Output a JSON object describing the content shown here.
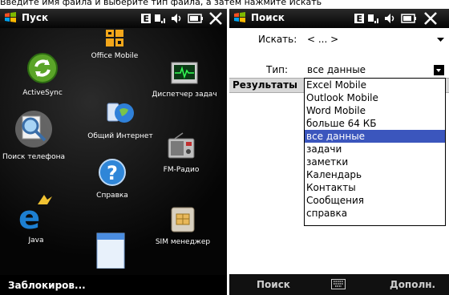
{
  "caption": "Введите имя файла и выберите тип файла, а затем нажмите Искать",
  "start_screen": {
    "title": "Пуск",
    "apps": [
      {
        "label": "Office Mobile"
      },
      {
        "label": "ActiveSync"
      },
      {
        "label": "Диспетчер задач"
      },
      {
        "label": "Общий Интернет"
      },
      {
        "label": "Поиск телефона"
      },
      {
        "label": "FM-Радио"
      },
      {
        "label": "Справка"
      },
      {
        "label": "Java"
      },
      {
        "label": "SIM менеджер"
      }
    ],
    "bottom_left": "Заблокиров..."
  },
  "search_screen": {
    "title": "Поиск",
    "search_label": "Искать:",
    "search_value": "< ... >",
    "type_label": "Тип:",
    "type_value": "все данные",
    "results_label": "Результаты",
    "dropdown_options": [
      "Excel Mobile",
      "Outlook Mobile",
      "Word Mobile",
      "больше 64 КБ",
      "все данные",
      "задачи",
      "заметки",
      "Календарь",
      "Контакты",
      "Сообщения",
      "справка"
    ],
    "selected_option": "все данные",
    "softkey_left": "Поиск",
    "softkey_right": "Дополн."
  }
}
